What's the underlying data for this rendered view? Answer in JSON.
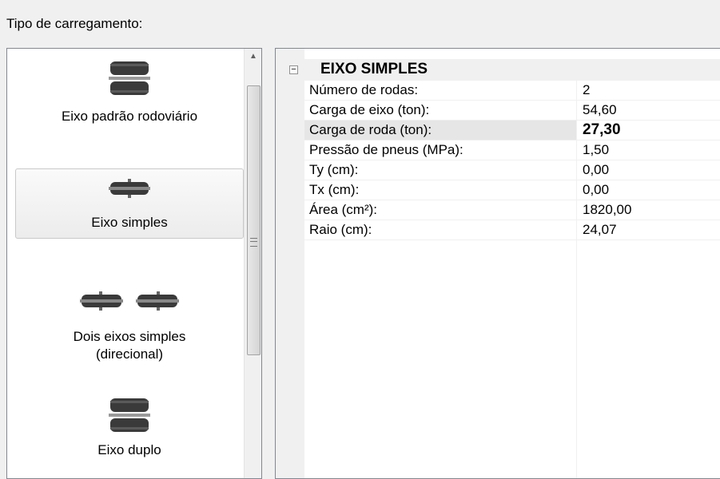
{
  "header": {
    "label": "Tipo de carregamento:"
  },
  "load_types": [
    {
      "label": "Eixo padrão rodoviário",
      "icon": "dual-wheel-icon",
      "selected": false
    },
    {
      "label": "Eixo simples",
      "icon": "single-wheel-icon",
      "selected": true
    },
    {
      "label": "Dois eixos simples\n(direcional)",
      "icon": "two-single-wheels-icon",
      "selected": false
    },
    {
      "label": "Eixo duplo",
      "icon": "dual-wheel-icon",
      "selected": false
    }
  ],
  "scrollbar": {
    "up_arrow": "▲"
  },
  "property_grid": {
    "category": "EIXO SIMPLES",
    "collapse_symbol": "−",
    "rows": [
      {
        "name": "Número de rodas:",
        "value": "2"
      },
      {
        "name": "Carga de eixo (ton):",
        "value": "54,60"
      },
      {
        "name": "Carga de roda (ton):",
        "value": "27,30",
        "selected": true
      },
      {
        "name": "Pressão de pneus (MPa):",
        "value": "1,50"
      },
      {
        "name": "Ty (cm):",
        "value": "0,00"
      },
      {
        "name": "Tx (cm):",
        "value": "0,00"
      },
      {
        "name": "Área (cm²):",
        "value": "1820,00"
      },
      {
        "name": "Raio (cm):",
        "value": "24,07"
      }
    ]
  }
}
